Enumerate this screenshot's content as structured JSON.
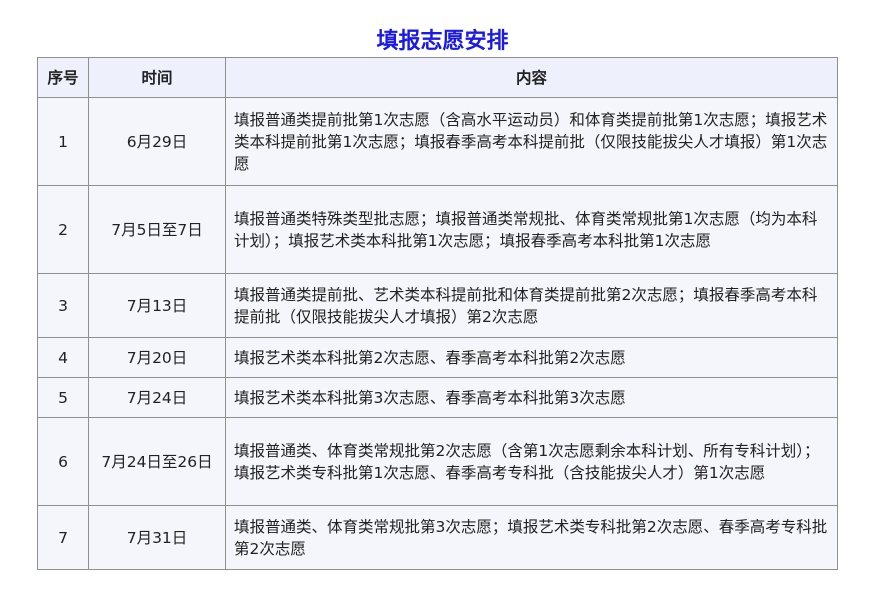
{
  "page": {
    "title": "填报志愿安排"
  },
  "table": {
    "headers": [
      "序号",
      "时间",
      "内容"
    ],
    "rows": [
      {
        "no": "1",
        "date": "6月29日",
        "content": "填报普通类提前批第1次志愿（含高水平运动员）和体育类提前批第1次志愿；填报艺术类本科提前批第1次志愿；填报春季高考本科提前批（仅限技能拔尖人才填报）第1次志愿"
      },
      {
        "no": "2",
        "date": "7月5日至7日",
        "content": "填报普通类特殊类型批志愿；填报普通类常规批、体育类常规批第1次志愿（均为本科计划）；填报艺术类本科批第1次志愿；填报春季高考本科批第1次志愿"
      },
      {
        "no": "3",
        "date": "7月13日",
        "content": "填报普通类提前批、艺术类本科提前批和体育类提前批第2次志愿；填报春季高考本科提前批（仅限技能拔尖人才填报）第2次志愿"
      },
      {
        "no": "4",
        "date": "7月20日",
        "content": "填报艺术类本科批第2次志愿、春季高考本科批第2次志愿"
      },
      {
        "no": "5",
        "date": "7月24日",
        "content": "填报艺术类本科批第3次志愿、春季高考本科批第3次志愿"
      },
      {
        "no": "6",
        "date": "7月24日至26日",
        "content": "填报普通类、体育类常规批第2次志愿（含第1次志愿剩余本科计划、所有专科计划）；填报艺术类专科批第1次志愿、春季高考专科批（含技能拔尖人才）第1次志愿"
      },
      {
        "no": "7",
        "date": "7月31日",
        "content": "填报普通类、体育类常规批第3次志愿；填报艺术类专科批第2次志愿、春季高考专科批第2次志愿"
      }
    ]
  },
  "colors": {
    "title": "#1a1ae6",
    "header_bg": "#eef0fc",
    "cell_bg": "#f5f6fb",
    "border": "#8f8f8f"
  }
}
